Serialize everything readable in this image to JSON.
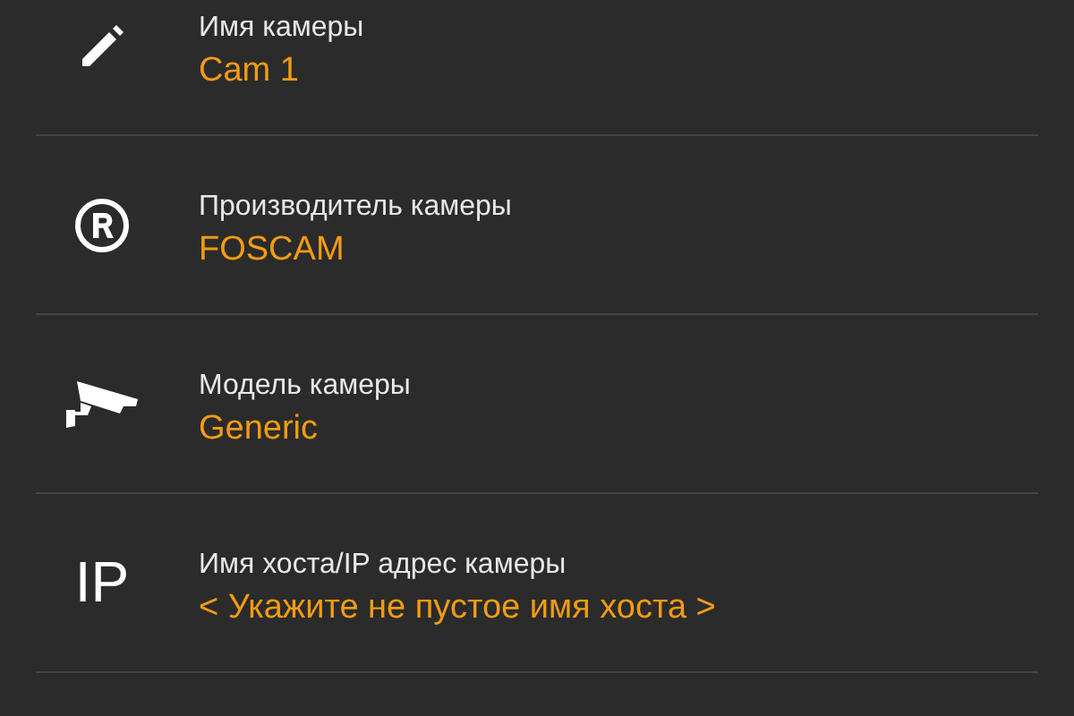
{
  "settings": [
    {
      "kind": "pencil",
      "label": "Имя камеры",
      "value": "Cam 1"
    },
    {
      "kind": "registered",
      "label": "Производитель камеры",
      "value": "FOSCAM"
    },
    {
      "kind": "camera",
      "label": "Модель камеры",
      "value": "Generic"
    },
    {
      "kind": "text",
      "icon_text": "IP",
      "label": "Имя хоста/IP адрес камеры",
      "value": "< Укажите не пустое имя хоста >"
    }
  ]
}
